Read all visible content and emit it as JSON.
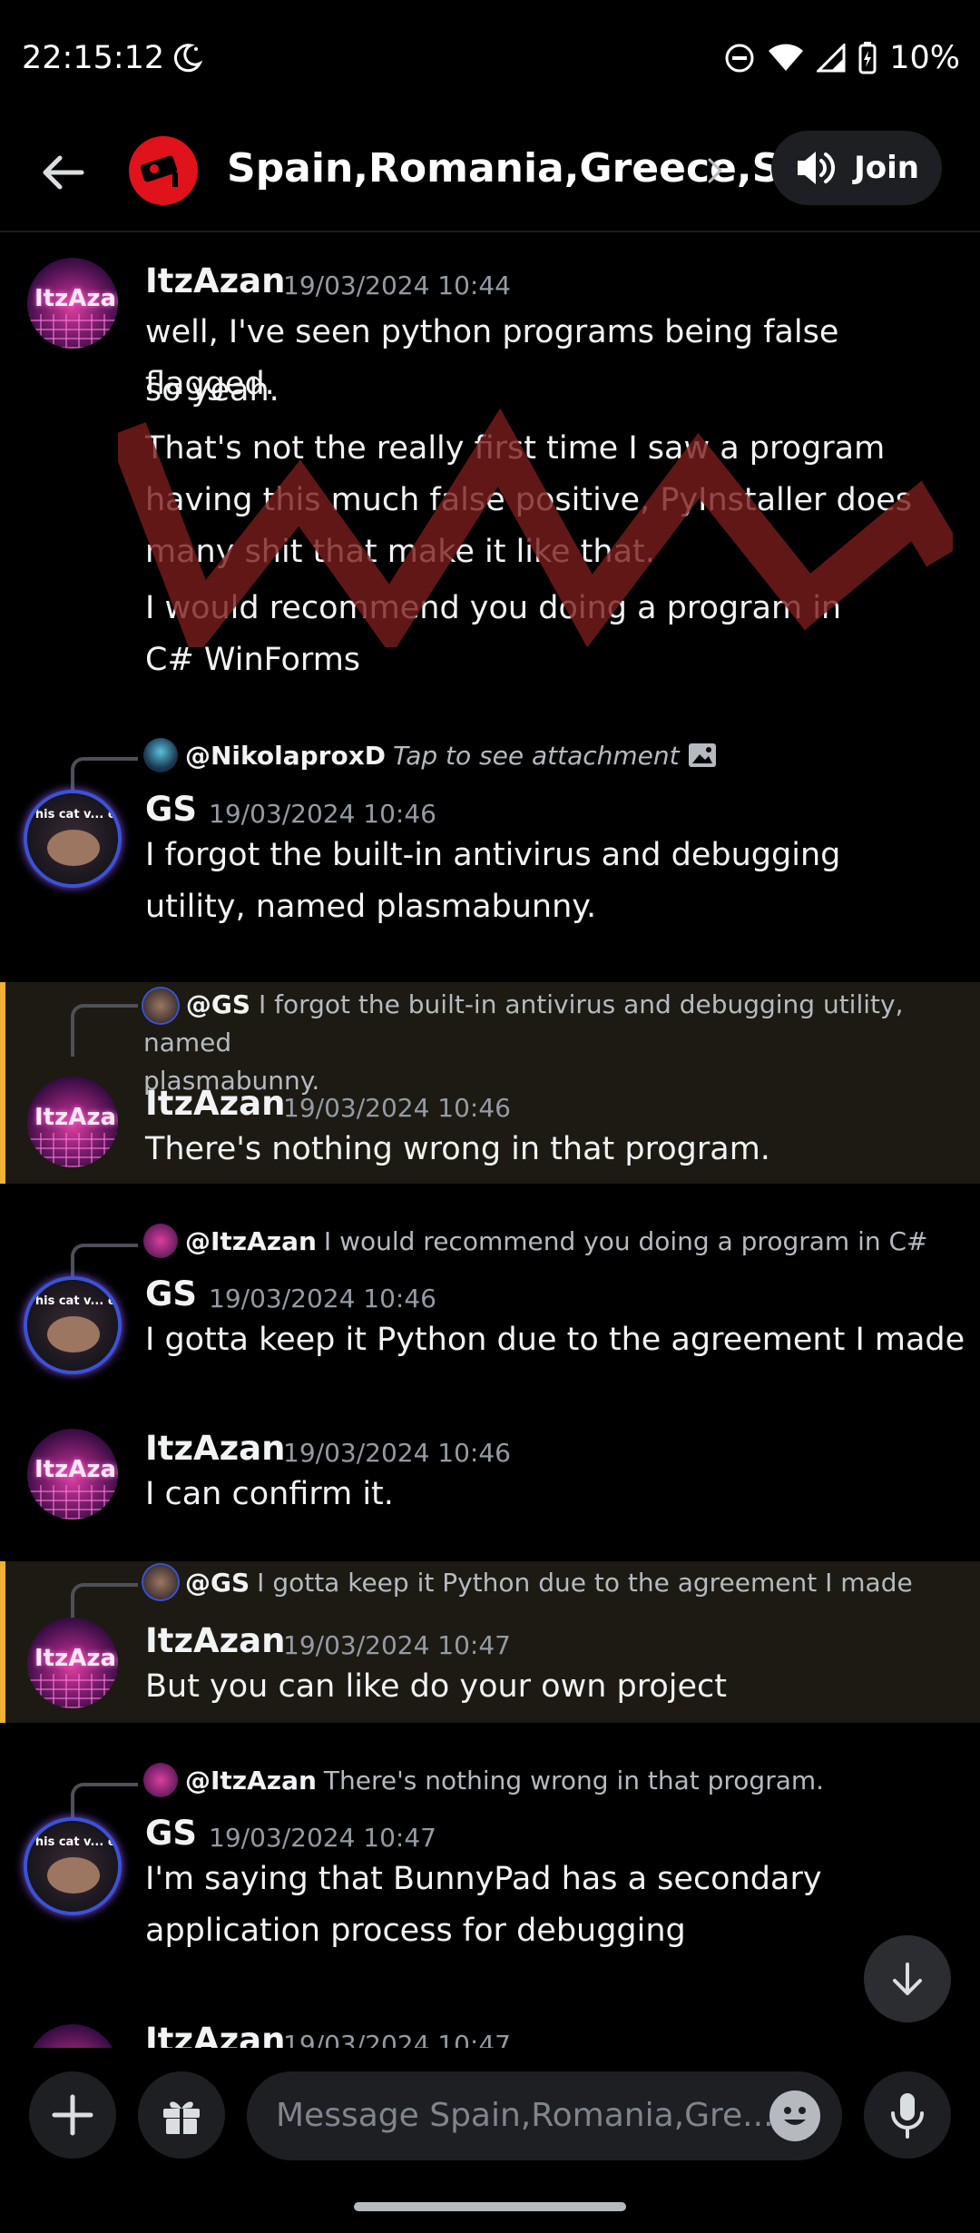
{
  "status_bar": {
    "time": "22:15:12",
    "battery": "10%",
    "icons": [
      "moon-icon",
      "dnd-icon",
      "wifi-icon",
      "signal-icon",
      "battery-icon"
    ]
  },
  "header": {
    "channel_title": "Spain,Romania,Greece,S..",
    "join_label": "Join",
    "icons": [
      "back-arrow-icon",
      "channel-icon",
      "chevron-right-icon",
      "speaker-icon"
    ]
  },
  "messages": [
    {
      "author": "ItzAzan",
      "timestamp": "19/03/2024 10:44",
      "avatar_text": "ItzAzan",
      "lines": [
        "well, I've seen python programs being false flagged.",
        "so yeah.",
        "That's not the really first time I saw a program having this much false positive, PyInstaller does many shit that make it like that.",
        "I would recommend you doing a program in C# WinForms"
      ]
    },
    {
      "reply_to": {
        "name": "@NikolaproxD",
        "text": "Tap to see attachment"
      },
      "author": "GS",
      "timestamp": "19/03/2024 10:46",
      "avatar_text": "This cat v... ey least expect",
      "text": "I forgot the built-in antivirus and debugging utility, named plasmabunny."
    },
    {
      "reply_to": {
        "name": "@GS",
        "text": "I forgot the built-in antivirus and debugging utility, named",
        "text2": "plasmabunny."
      },
      "author": "ItzAzan",
      "timestamp": "19/03/2024 10:46",
      "text": "There's nothing wrong in that program.",
      "highlighted": true
    },
    {
      "reply_to": {
        "name": "@ItzAzan",
        "text": "I would recommend you doing a program in C#"
      },
      "author": "GS",
      "timestamp": "19/03/2024 10:46",
      "text": "I gotta keep it Python due to the agreement I made"
    },
    {
      "author": "ItzAzan",
      "timestamp": "19/03/2024 10:46",
      "text": "I can confirm it."
    },
    {
      "reply_to": {
        "name": "@GS",
        "text": "I gotta keep it Python due to the agreement I made"
      },
      "author": "ItzAzan",
      "timestamp": "19/03/2024 10:47",
      "text": "But you can like do your own project",
      "highlighted": true
    },
    {
      "reply_to": {
        "name": "@ItzAzan",
        "text": "There's nothing wrong in that program."
      },
      "author": "GS",
      "timestamp": "19/03/2024 10:47",
      "text": "I'm saying that BunnyPad has a secondary application process for debugging"
    },
    {
      "author": "ItzAzan",
      "timestamp": "19/03/2024 10:47"
    }
  ],
  "composer": {
    "placeholder": "Message Spain,Romania,Gre...",
    "icons": [
      "plus-icon",
      "gift-icon",
      "emoji-icon",
      "microphone-icon"
    ]
  },
  "colors": {
    "background": "#000000",
    "highlight_bar": "#f0b232",
    "highlight_bg": "#1c1a12",
    "scribble": "#7a1d1d",
    "channel_icon": "#e0121a"
  }
}
